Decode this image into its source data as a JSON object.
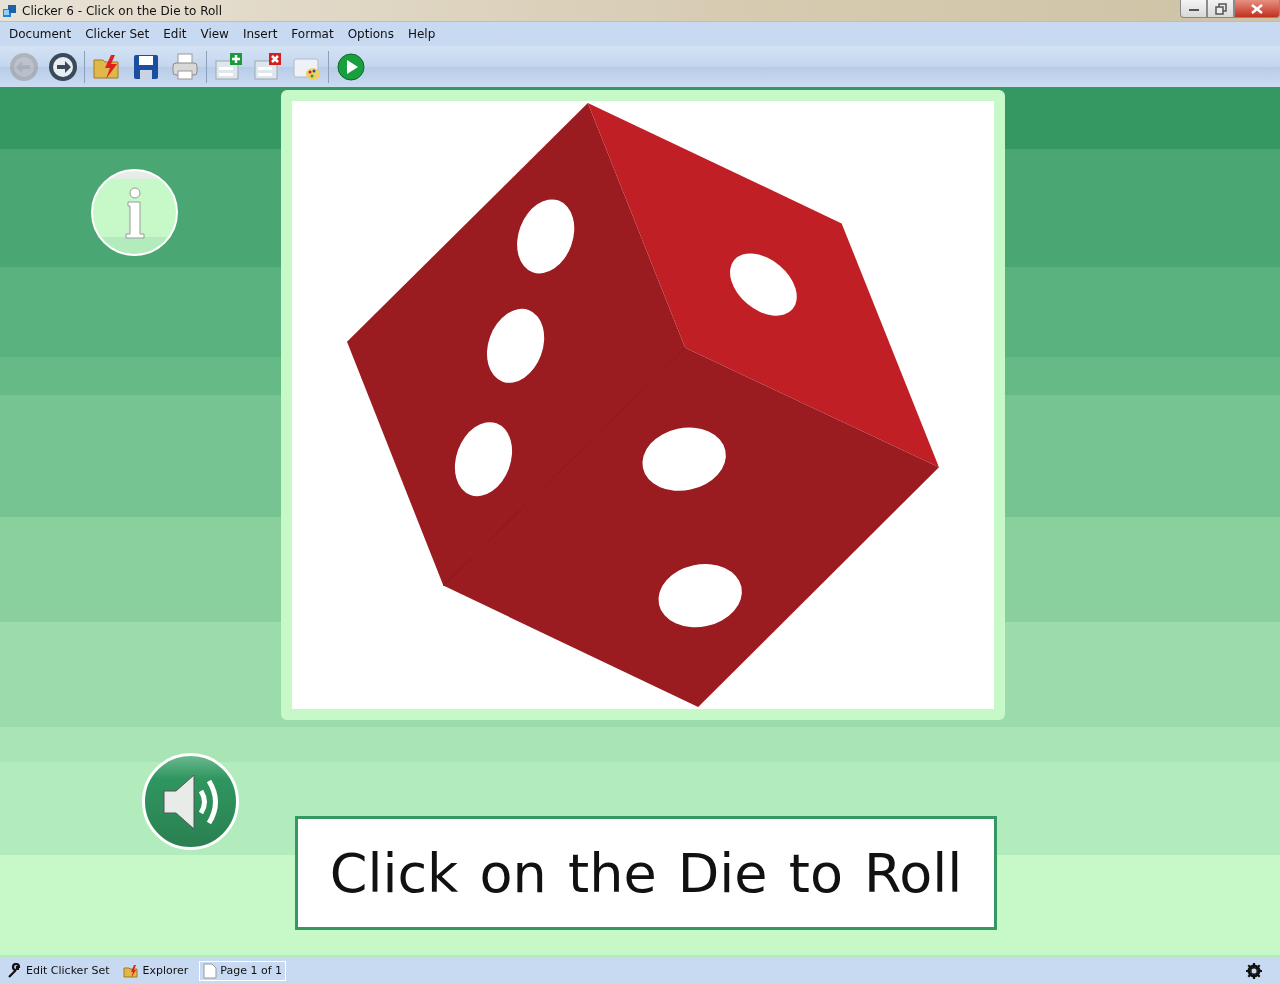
{
  "window": {
    "title": "Clicker 6 - Click on the Die to Roll"
  },
  "menu": [
    "Document",
    "Clicker Set",
    "Edit",
    "View",
    "Insert",
    "Format",
    "Options",
    "Help"
  ],
  "toolbar": [
    [
      {
        "kind": "back",
        "disabled": true
      },
      {
        "kind": "forward",
        "disabled": false
      }
    ],
    [
      {
        "kind": "open",
        "disabled": false
      },
      {
        "kind": "save",
        "disabled": false
      },
      {
        "kind": "print",
        "disabled": false
      }
    ],
    [
      {
        "kind": "add-page",
        "disabled": false
      },
      {
        "kind": "delete-page",
        "disabled": false
      },
      {
        "kind": "palette",
        "disabled": false
      }
    ],
    [
      {
        "kind": "play",
        "disabled": false
      }
    ]
  ],
  "sentence": "Click on the Die to Roll",
  "status_bar": [
    {
      "kind": "edit",
      "label": "Edit Clicker Set"
    },
    {
      "kind": "explorer",
      "label": "Explorer"
    },
    {
      "kind": "page",
      "label": "Page 1 of 1"
    }
  ]
}
